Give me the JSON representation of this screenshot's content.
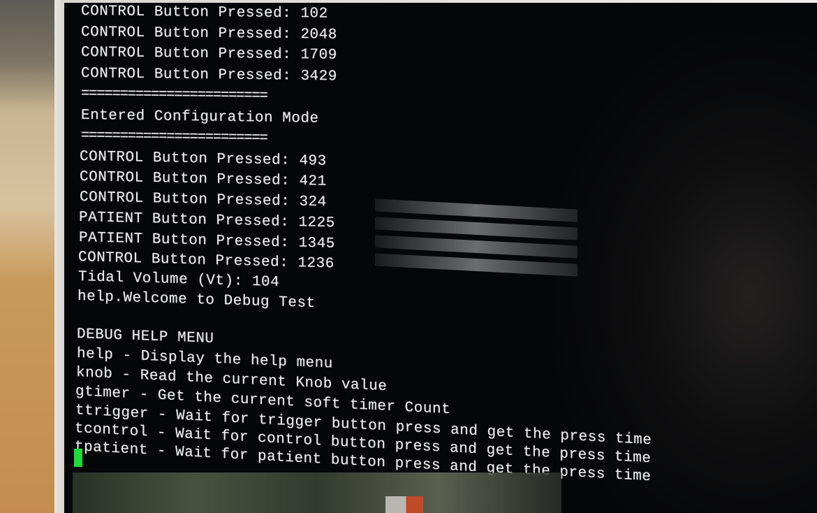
{
  "terminal": {
    "lines": [
      "CONTROL Button Pressed: 102",
      "CONTROL Button Pressed: 2048",
      "CONTROL Button Pressed: 1709",
      "CONTROL Button Pressed: 3429",
      "========================",
      "Entered Configuration Mode",
      "========================",
      "CONTROL Button Pressed: 493",
      "CONTROL Button Pressed: 421",
      "CONTROL Button Pressed: 324",
      "PATIENT Button Pressed: 1225",
      "PATIENT Button Pressed: 1345",
      "CONTROL Button Pressed: 1236",
      "Tidal Volume (Vt): 104",
      "help.Welcome to Debug Test",
      "",
      "DEBUG HELP MENU",
      "help - Display the help menu",
      "knob - Read the current Knob value",
      "gtimer - Get the current soft timer Count",
      "ttrigger - Wait for trigger button press and get the press time",
      "tcontrol - Wait for control button press and get the press time",
      "tpatient - Wait for patient button press and get the press time"
    ],
    "cursor_color": "#1fdc3a",
    "text_color": "#ececec",
    "background_color": "#050608"
  }
}
